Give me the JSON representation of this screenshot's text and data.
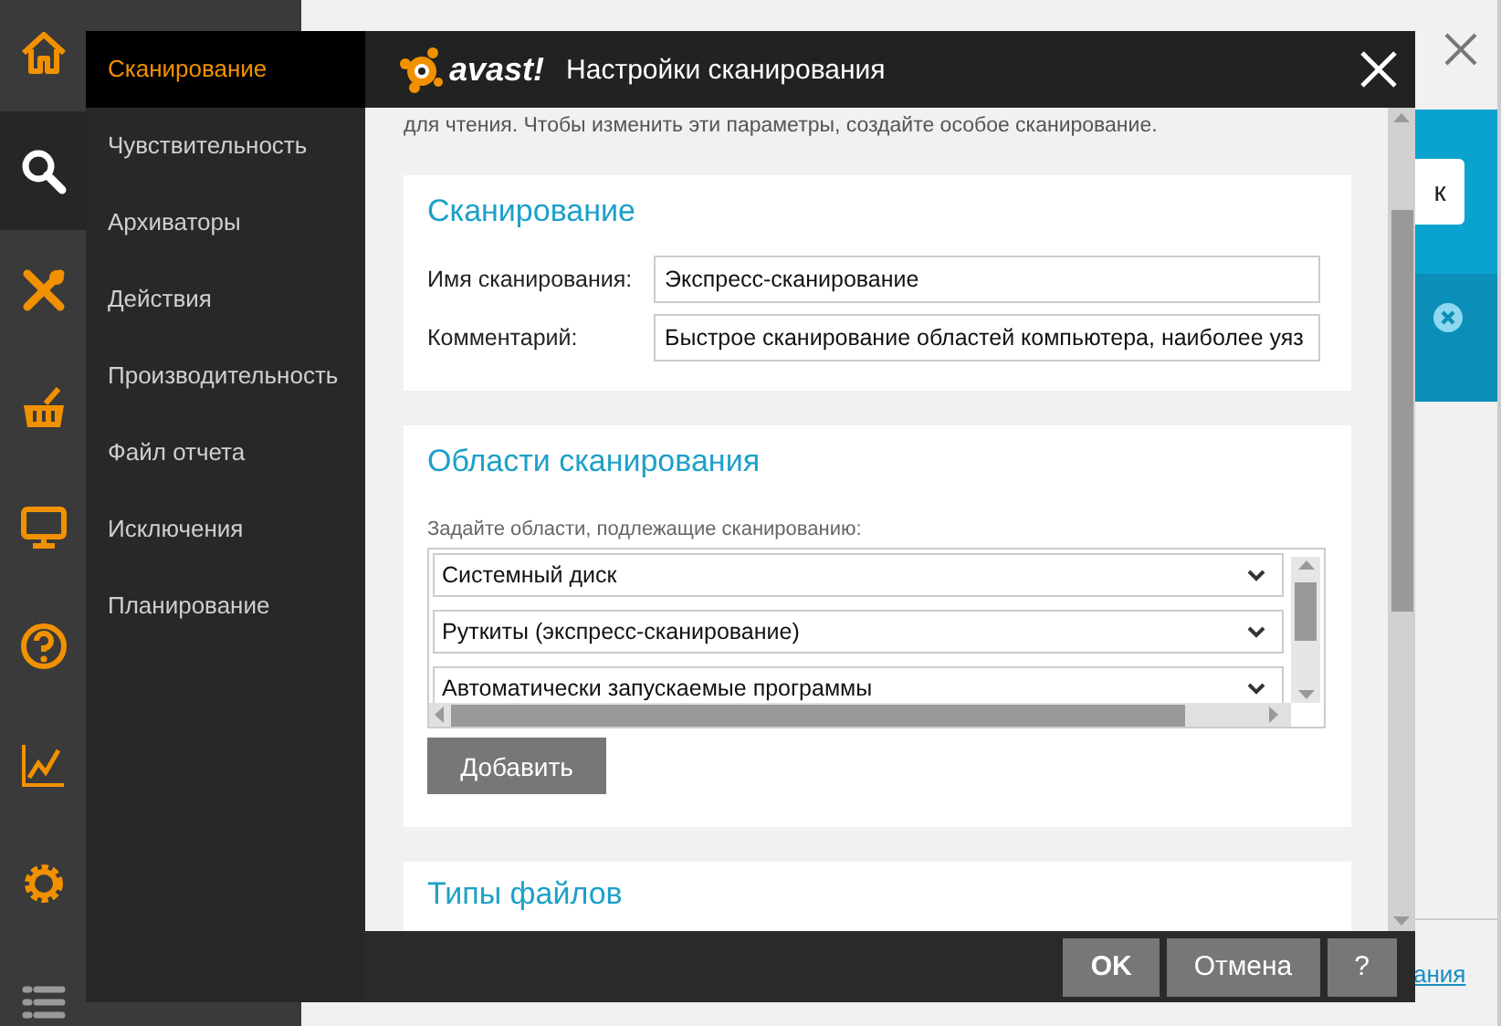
{
  "rail": {
    "items": [
      {
        "selected": false
      },
      {
        "selected": true
      },
      {
        "selected": false
      },
      {
        "selected": false
      },
      {
        "selected": false
      },
      {
        "selected": false
      },
      {
        "selected": false
      },
      {
        "selected": false
      },
      {
        "selected": false
      }
    ]
  },
  "menu": {
    "items": [
      {
        "label": "Сканирование",
        "selected": true
      },
      {
        "label": "Чувствительность",
        "selected": false
      },
      {
        "label": "Архиваторы",
        "selected": false
      },
      {
        "label": "Действия",
        "selected": false
      },
      {
        "label": "Производительность",
        "selected": false
      },
      {
        "label": "Файл отчета",
        "selected": false
      },
      {
        "label": "Исключения",
        "selected": false
      },
      {
        "label": "Планирование",
        "selected": false
      }
    ]
  },
  "background": {
    "button": "к",
    "link": "ания"
  },
  "dialog": {
    "logo_text": "avast!",
    "title": "Настройки сканирования",
    "intro": "для чтения. Чтобы изменить эти параметры, создайте особое сканирование.",
    "scan_section": {
      "heading": "Сканирование",
      "fields": [
        {
          "label": "Имя сканирования:",
          "value": "Экспресс-сканирование"
        },
        {
          "label": "Комментарий:",
          "value": "Быстрое сканирование областей компьютера, наиболее уяз"
        }
      ]
    },
    "areas_section": {
      "heading": "Области сканирования",
      "hint": "Задайте области, подлежащие сканированию:",
      "areas": [
        "Системный диск",
        "Руткиты (экспресс-сканирование)",
        "Автоматически запускаемые программы"
      ],
      "add_button": "Добавить"
    },
    "file_types_section": {
      "heading": "Типы файлов"
    },
    "buttons": [
      "OK",
      "Отмена",
      "?"
    ]
  }
}
